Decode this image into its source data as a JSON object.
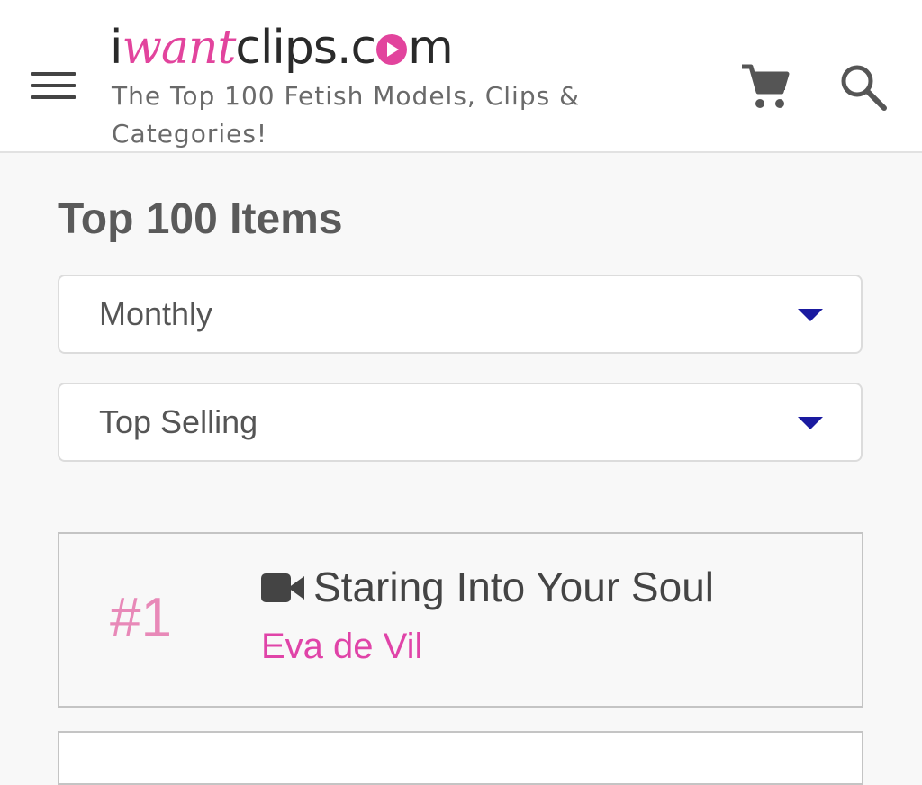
{
  "header": {
    "logo_prefix": "i",
    "logo_accent": "want",
    "logo_suffix": "clips.c",
    "logo_end": "m",
    "tagline": "The Top 100 Fetish Models, Clips & Categories!"
  },
  "main": {
    "title": "Top 100 Items",
    "period_select": {
      "value": "Monthly"
    },
    "sort_select": {
      "value": "Top Selling"
    },
    "items": [
      {
        "rank": "#1",
        "title": "Staring Into Your Soul",
        "model": "Eva de Vil",
        "type_icon": "video-camera-icon"
      }
    ]
  },
  "colors": {
    "brand_pink": "#e2449d",
    "rank_pink": "#e889b8",
    "caret_blue": "#1a1aa0"
  }
}
